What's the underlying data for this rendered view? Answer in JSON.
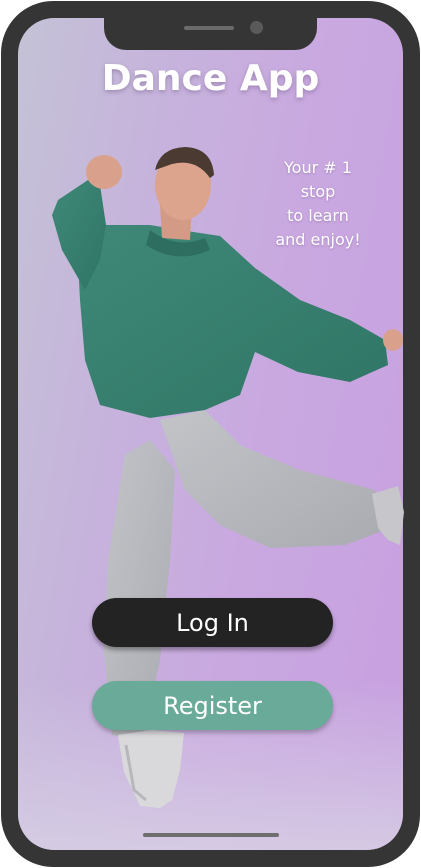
{
  "app": {
    "title": "Dance App",
    "tagline": [
      "Your # 1",
      "stop",
      "to learn",
      "and enjoy!"
    ]
  },
  "buttons": {
    "login_label": "Log In",
    "register_label": "Register"
  },
  "colors": {
    "login_button": "#232323",
    "register_button": "#6aaa98",
    "phone_frame": "#353535",
    "background_purple": "#c9a8e0"
  }
}
